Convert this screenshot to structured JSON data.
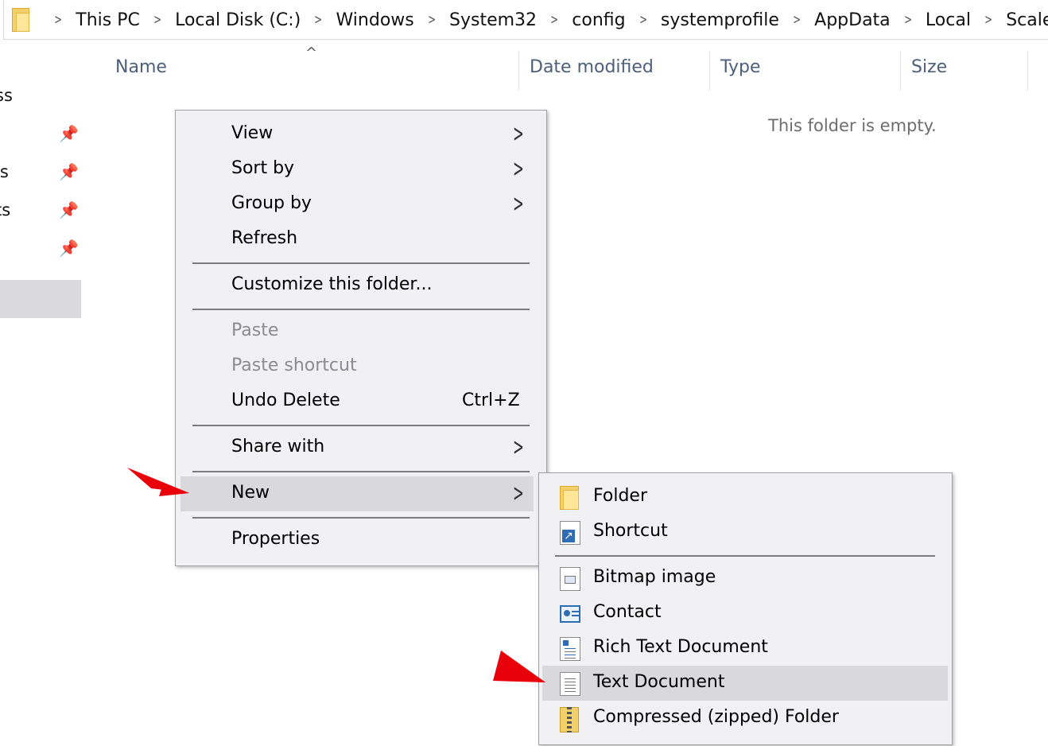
{
  "breadcrumb": [
    "This PC",
    "Local Disk (C:)",
    "Windows",
    "System32",
    "config",
    "systemprofile",
    "AppData",
    "Local",
    "ScaleFT"
  ],
  "nav_pane": {
    "labels": [
      "ss",
      "ls",
      "ts"
    ],
    "pin_glyph": "📌"
  },
  "columns": {
    "name": "Name",
    "date_modified": "Date modified",
    "type": "Type",
    "size": "Size",
    "sort_indicator": "^"
  },
  "empty_message": "This folder is empty.",
  "context_menu": {
    "view": "View",
    "sort_by": "Sort by",
    "group_by": "Group by",
    "refresh": "Refresh",
    "customize": "Customize this folder...",
    "paste": "Paste",
    "paste_shortcut": "Paste shortcut",
    "undo_delete": "Undo Delete",
    "undo_shortcut": "Ctrl+Z",
    "share_with": "Share with",
    "new": "New",
    "properties": "Properties",
    "submenu_arrow": ">"
  },
  "new_submenu": {
    "folder": "Folder",
    "shortcut": "Shortcut",
    "bitmap": "Bitmap image",
    "contact": "Contact",
    "rich_text": "Rich Text Document",
    "text_document": "Text Document",
    "zip_folder": "Compressed (zipped) Folder"
  },
  "colors": {
    "highlight": "#d9d8dc",
    "annotation_arrow": "#e8000b",
    "header_text": "#4c607a"
  }
}
